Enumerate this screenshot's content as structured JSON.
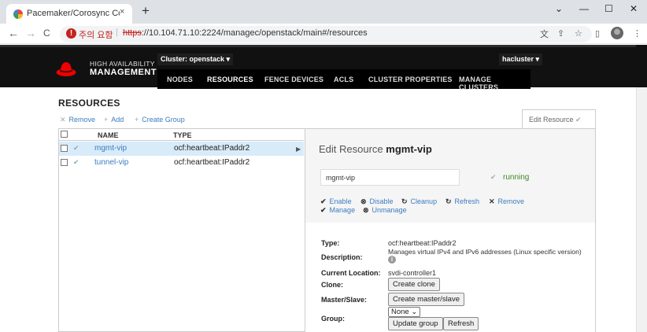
{
  "browser": {
    "tab_title": "Pacemaker/Corosync Configurat",
    "tab_close": "×",
    "new_tab": "+",
    "win_minimize": "—",
    "win_maximize": "☐",
    "win_close": "✕",
    "win_menu": "⌄",
    "nav_back": "←",
    "nav_forward": "→",
    "nav_reload": "C",
    "security_warning": "주의 요함",
    "url_scheme": "https",
    "url_rest": "://10.104.71.10:2224/managec/openstack/main#/resources"
  },
  "header": {
    "brand_line1": "HIGH AVAILABILITY",
    "brand_line2": "MANAGEMENT",
    "cluster_selector": "Cluster: openstack ▾",
    "user_menu": "hacluster ▾",
    "nav": [
      "NODES",
      "RESOURCES",
      "FENCE DEVICES",
      "ACLS",
      "CLUSTER PROPERTIES",
      "MANAGE CLUSTERS"
    ],
    "active_nav": "RESOURCES"
  },
  "resources": {
    "title": "RESOURCES",
    "actions": {
      "remove": "Remove",
      "add": "Add",
      "create_group": "Create Group"
    },
    "columns": {
      "name": "NAME",
      "type": "TYPE"
    },
    "rows": [
      {
        "name": "mgmt-vip",
        "type": "ocf:heartbeat:IPaddr2",
        "selected": true
      },
      {
        "name": "tunnel-vip",
        "type": "ocf:heartbeat:IPaddr2",
        "selected": false
      }
    ]
  },
  "edit": {
    "tab_label": "Edit Resource",
    "title_prefix": "Edit Resource",
    "resource_name": "mgmt-vip",
    "status": "running",
    "actions": {
      "enable": "Enable",
      "disable": "Disable",
      "cleanup": "Cleanup",
      "refresh": "Refresh",
      "remove": "Remove",
      "manage": "Manage",
      "unmanage": "Unmanage"
    },
    "labels": {
      "type": "Type:",
      "description": "Description:",
      "current_location": "Current Location:",
      "clone": "Clone:",
      "master_slave": "Master/Slave:",
      "group": "Group:"
    },
    "values": {
      "type": "ocf:heartbeat:IPaddr2",
      "description": "Manages virtual IPv4 and IPv6 addresses (Linux specific version)",
      "current_location": "svdi-controller1"
    },
    "buttons": {
      "create_clone": "Create clone",
      "create_master_slave": "Create master/slave",
      "update_group": "Update group",
      "refresh": "Refresh"
    },
    "group_select": "None ⌄"
  },
  "colors": {
    "brand_red": "#ee0000",
    "link_blue": "#3b7dbf",
    "status_green": "#3a8a2a",
    "header_bg": "#111111"
  }
}
